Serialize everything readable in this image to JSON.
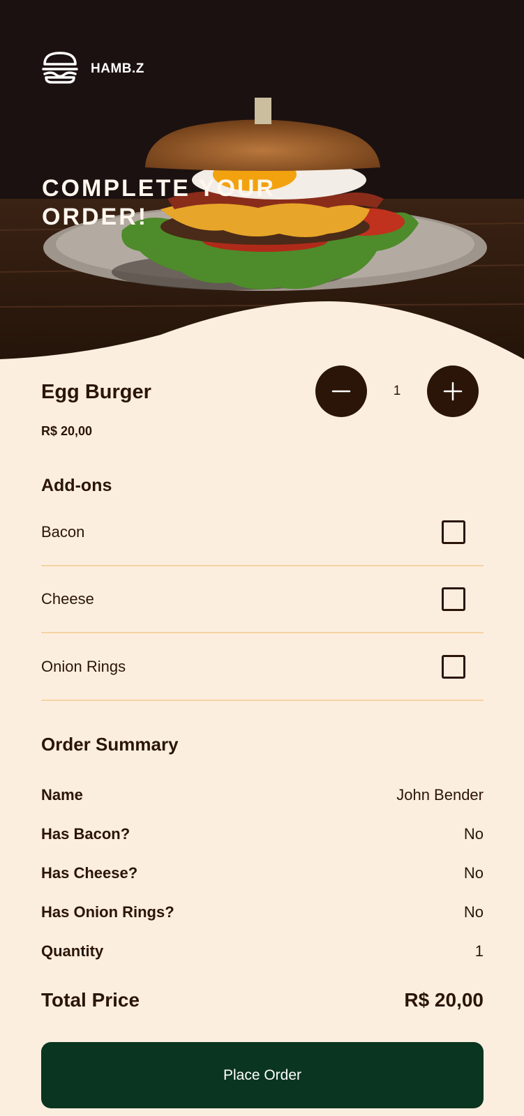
{
  "brand": {
    "name": "HAMB.Z",
    "icon": "burger-icon"
  },
  "hero": {
    "title_line1": "COMPLETE YOUR",
    "title_line2": "ORDER!"
  },
  "product": {
    "name": "Egg Burger",
    "price": "R$ 20,00"
  },
  "quantity": {
    "value": "1",
    "decrement_icon": "minus-icon",
    "increment_icon": "plus-icon"
  },
  "addons": {
    "title": "Add-ons",
    "items": [
      {
        "label": "Bacon",
        "checked": false
      },
      {
        "label": "Cheese",
        "checked": false
      },
      {
        "label": "Onion Rings",
        "checked": false
      }
    ]
  },
  "summary": {
    "title": "Order Summary",
    "rows": [
      {
        "key": "Name",
        "value": "John Bender"
      },
      {
        "key": "Has Bacon?",
        "value": "No"
      },
      {
        "key": "Has Cheese?",
        "value": "No"
      },
      {
        "key": "Has Onion Rings?",
        "value": "No"
      },
      {
        "key": "Quantity",
        "value": "1"
      }
    ],
    "total_label": "Total Price",
    "total_value": "R$ 20,00"
  },
  "actions": {
    "place_order": "Place Order"
  },
  "colors": {
    "background": "#FCEEDF",
    "text": "#2A1508",
    "primary_button": "#0A3520",
    "divider": "#F5D3A2",
    "hero_dark": "#1C1211"
  }
}
